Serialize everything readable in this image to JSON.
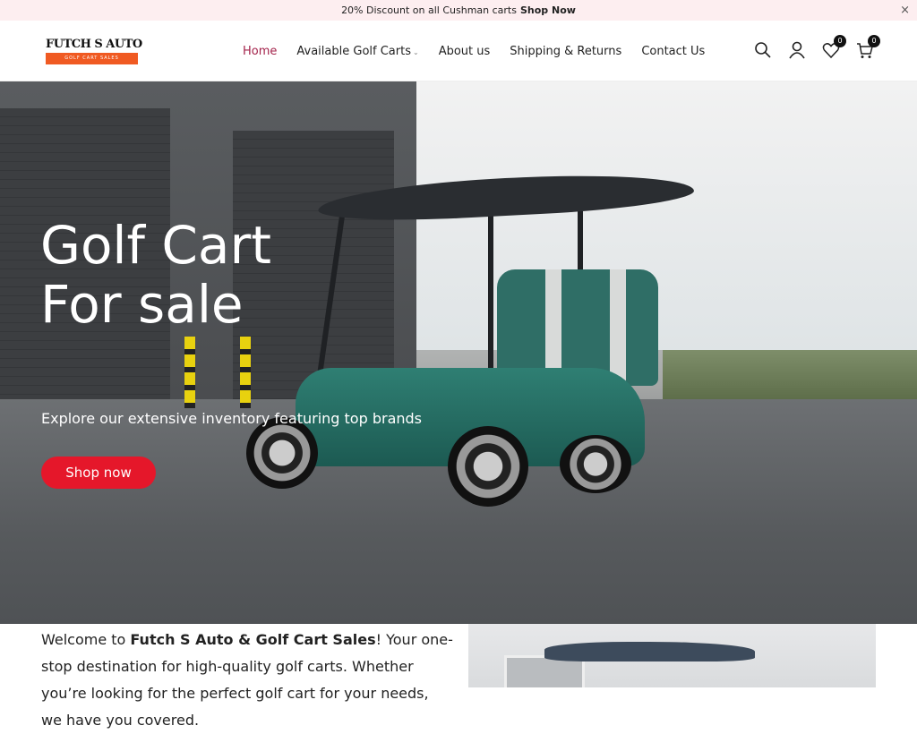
{
  "announcement": {
    "text": "20% Discount on all Cushman carts",
    "link": "Shop Now",
    "close_icon": "×"
  },
  "logo": {
    "name": "FUTCH S AUTO",
    "tagline": "GOLF CART SALES"
  },
  "nav": {
    "items": [
      {
        "label": "Home",
        "active": true
      },
      {
        "label": "Available Golf Carts",
        "dropdown": true
      },
      {
        "label": "About us"
      },
      {
        "label": "Shipping & Returns"
      },
      {
        "label": "Contact Us"
      }
    ],
    "dropdown_icon": "⌄"
  },
  "header_icons": {
    "search": "search-icon",
    "account": "user-icon",
    "wishlist": {
      "icon": "heart-icon",
      "count": "0"
    },
    "cart": {
      "icon": "cart-icon",
      "count": "0"
    }
  },
  "hero": {
    "title_line1": "Golf Cart",
    "title_line2": "For sale",
    "subtitle": "Explore our extensive inventory featuring top brands",
    "cta": "Shop now",
    "cta_color": "#e5172a"
  },
  "welcome": {
    "prefix": "Welcome to ",
    "brand": "Futch S Auto & Golf Cart Sales",
    "suffix": "! Your one-stop destination for high-quality golf carts. Whether you’re looking for the perfect golf cart for your needs, we have you covered."
  },
  "colors": {
    "announcement_bg": "#fdeef0",
    "nav_active": "#a3224a",
    "logo_bar": "#f05a22"
  }
}
